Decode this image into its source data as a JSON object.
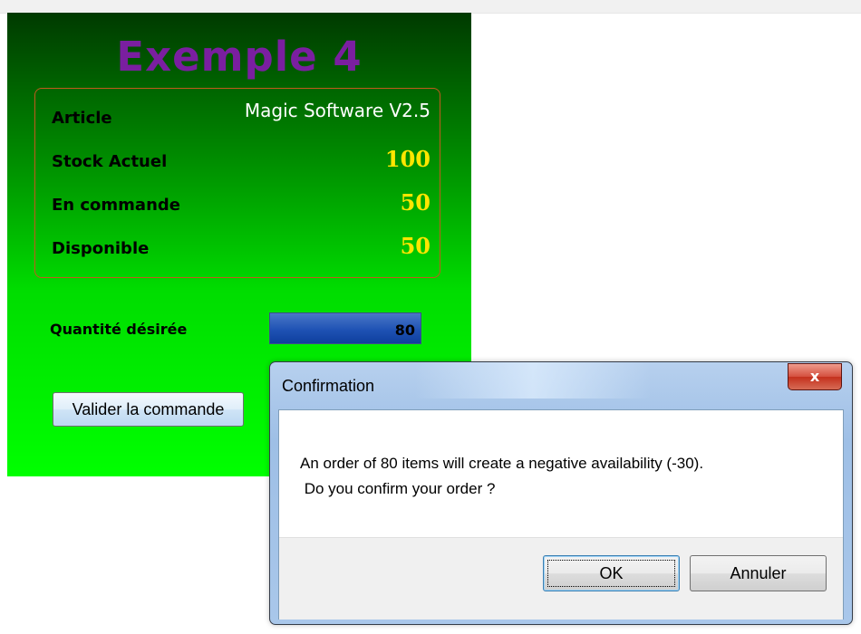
{
  "app": {
    "title": "Exemple 4",
    "fields": {
      "article_label": "Article",
      "article_value": "Magic Software V2.5",
      "stock_label": "Stock Actuel",
      "stock_value": "100",
      "order_label": "En commande",
      "order_value": "50",
      "available_label": "Disponible",
      "available_value": "50"
    },
    "quantity_label": "Quantité désirée",
    "quantity_value": "80",
    "validate_button": "Valider la commande",
    "colors": {
      "title": "#7a1fa0",
      "number": "#ffe600",
      "panel_top": "#003a00",
      "panel_bottom": "#00ff00",
      "box_border": "#c15a1e"
    }
  },
  "dialog": {
    "title": "Confirmation",
    "close_label": "x",
    "message_line1": "An order of 80 items will create a negative availability (-30).",
    "message_line2": " Do you confirm your order ?",
    "ok_label": "OK",
    "cancel_label": "Annuler"
  }
}
